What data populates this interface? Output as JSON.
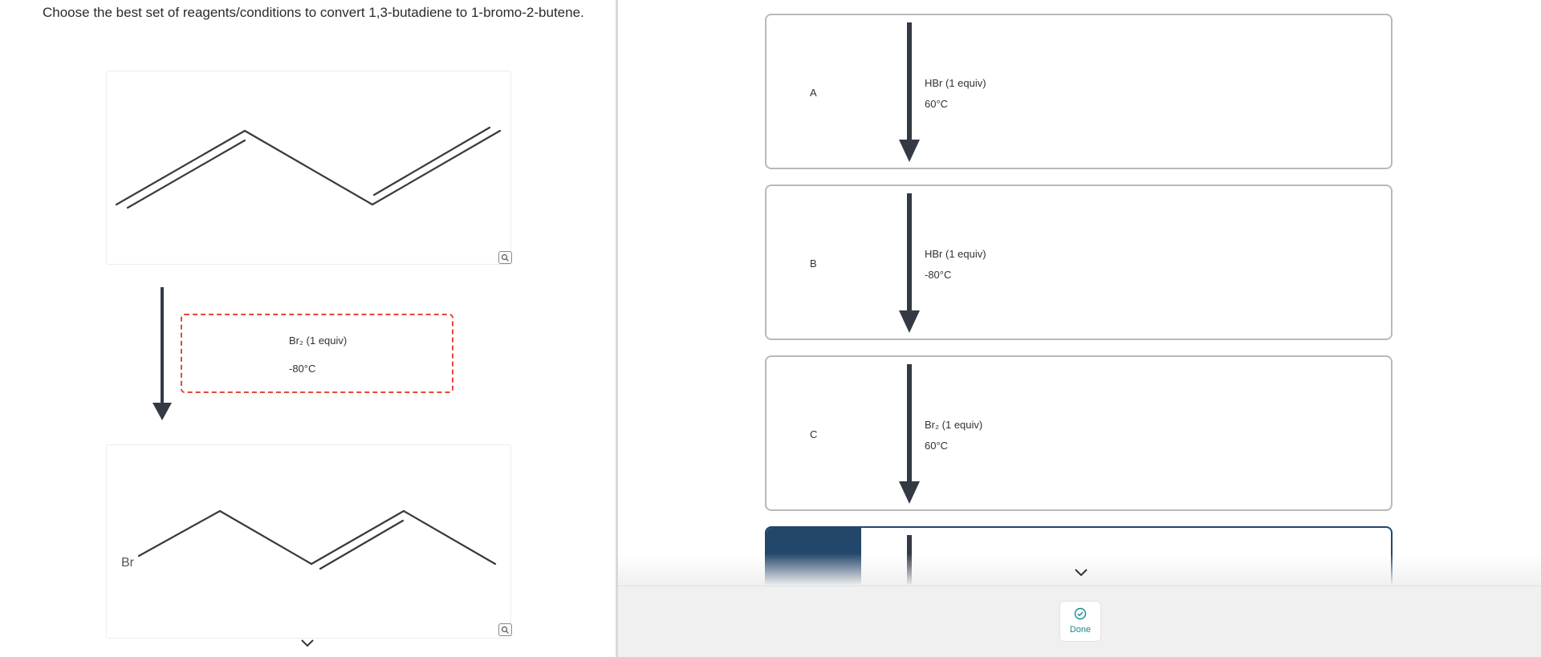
{
  "question": {
    "text": "Choose the best set of reagents/conditions to convert 1,3-butadiene to 1-bromo-2-butene."
  },
  "reaction": {
    "reagent_line1": "Br₂ (1 equiv)",
    "reagent_line2": "-80°C",
    "product_atom_label": "Br"
  },
  "options": [
    {
      "letter": "A",
      "line1": "HBr (1 equiv)",
      "line2": "60°C"
    },
    {
      "letter": "B",
      "line1": "HBr (1 equiv)",
      "line2": "-80°C"
    },
    {
      "letter": "C",
      "line1": "Br₂ (1 equiv)",
      "line2": "60°C"
    }
  ],
  "footer": {
    "done_label": "Done"
  },
  "icons": {
    "zoom": "magnifier-icon",
    "scroll": "chevron-down-icon",
    "done": "check-circle-icon"
  },
  "colors": {
    "dashed_border": "#e5463a",
    "selected_option": "#23476b",
    "done_text": "#1a8a8a"
  }
}
